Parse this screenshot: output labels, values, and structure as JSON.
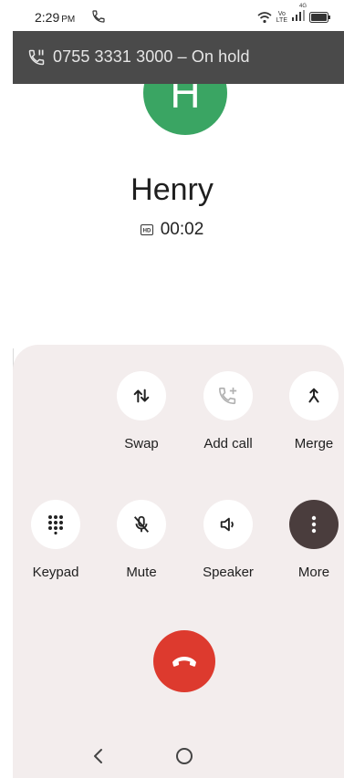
{
  "status_bar": {
    "time": "2:29",
    "ampm": "PM",
    "network_label_top": "Vo",
    "network_label_bottom": "LTE",
    "network_superscript": "4G"
  },
  "hold_banner": {
    "text": "0755 3331 3000 – On hold"
  },
  "caller": {
    "initial": "H",
    "name": "Henry",
    "timer": "00:02",
    "avatar_color": "#3aa563"
  },
  "controls": {
    "row1": [
      {
        "label": "Swap",
        "icon": "swap-icon"
      },
      {
        "label": "Add call",
        "icon": "add-call-icon"
      },
      {
        "label": "Merge",
        "icon": "merge-icon"
      }
    ],
    "row2": [
      {
        "label": "Keypad",
        "icon": "keypad-icon"
      },
      {
        "label": "Mute",
        "icon": "mute-icon"
      },
      {
        "label": "Speaker",
        "icon": "speaker-icon"
      },
      {
        "label": "More",
        "icon": "more-icon"
      }
    ]
  },
  "colors": {
    "banner": "#4a4a4a",
    "panel": "#f3eded",
    "end_call": "#dd3a2e",
    "more_button": "#4a3d3d"
  }
}
